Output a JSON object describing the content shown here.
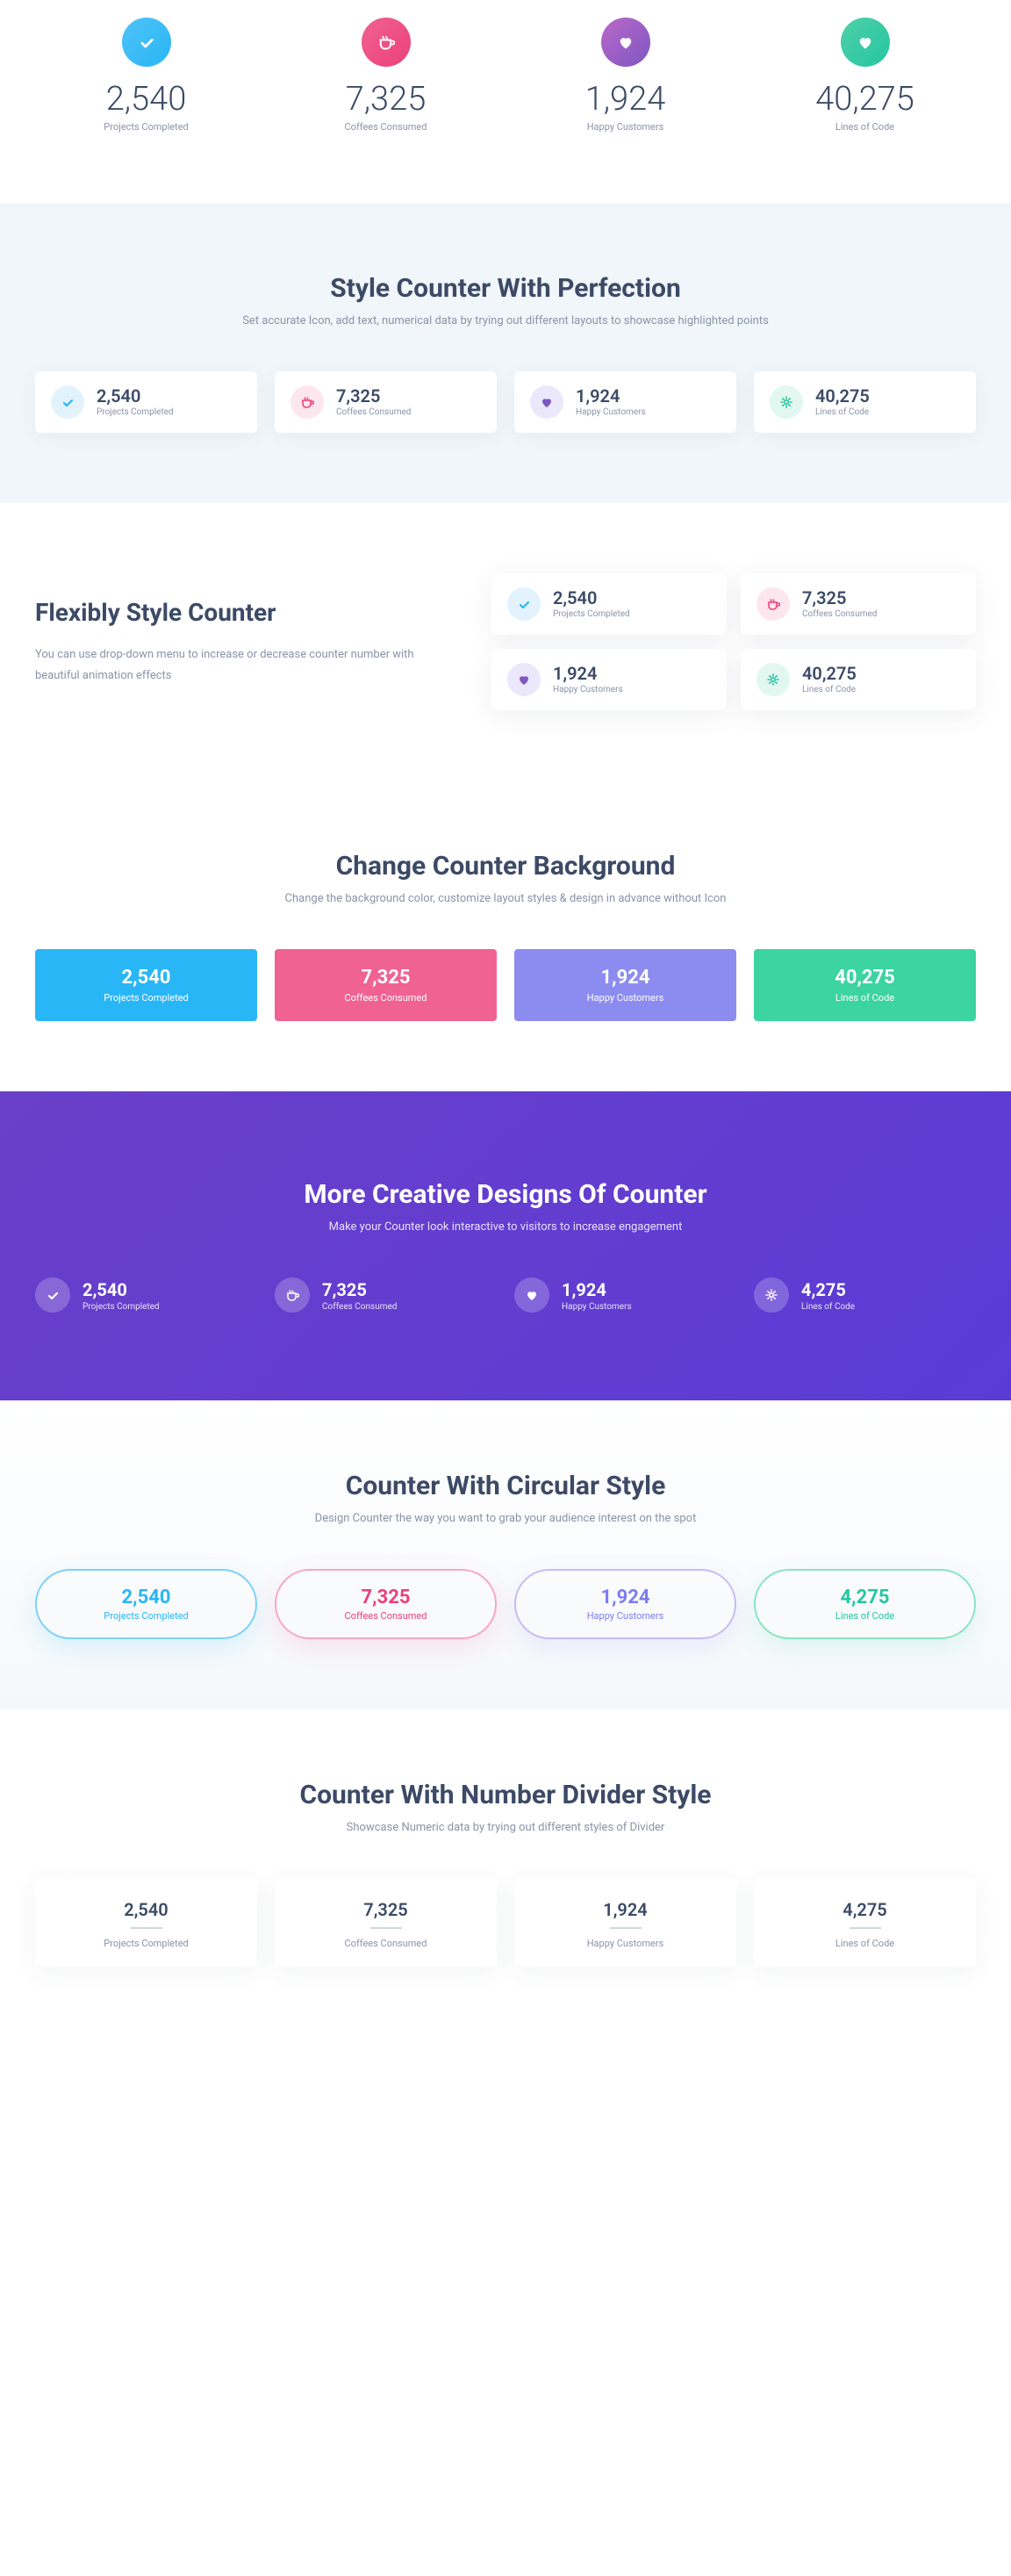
{
  "hero": {
    "items": [
      {
        "value": "2,540",
        "label": "Projects Completed",
        "icon": "check"
      },
      {
        "value": "7,325",
        "label": "Coffees Consumed",
        "icon": "coffee"
      },
      {
        "value": "1,924",
        "label": "Happy Customers",
        "icon": "heart"
      },
      {
        "value": "40,275",
        "label": "Lines of Code",
        "icon": "heart"
      }
    ]
  },
  "s2": {
    "title": "Style Counter With Perfection",
    "sub": "Set accurate Icon, add text, numerical data by trying out different layouts to showcase highlighted points",
    "items": [
      {
        "value": "2,540",
        "label": "Projects Completed",
        "icon": "check"
      },
      {
        "value": "7,325",
        "label": "Coffees Consumed",
        "icon": "coffee"
      },
      {
        "value": "1,924",
        "label": "Happy Customers",
        "icon": "heart"
      },
      {
        "value": "40,275",
        "label": "Lines of Code",
        "icon": "gear"
      }
    ]
  },
  "s3": {
    "title": "Flexibly Style Counter",
    "desc": "You can use drop-down menu to increase or decrease counter number with beautiful animation effects",
    "items": [
      {
        "value": "2,540",
        "label": "Projects Completed",
        "icon": "check"
      },
      {
        "value": "7,325",
        "label": "Coffees Consumed",
        "icon": "coffee"
      },
      {
        "value": "1,924",
        "label": "Happy Customers",
        "icon": "heart"
      },
      {
        "value": "40,275",
        "label": "Lines of Code",
        "icon": "gear"
      }
    ]
  },
  "s4": {
    "title": "Change Counter Background",
    "sub": "Change the background color, customize layout styles & design in advance without Icon",
    "items": [
      {
        "value": "2,540",
        "label": "Projects Completed"
      },
      {
        "value": "7,325",
        "label": "Coffees Consumed"
      },
      {
        "value": "1,924",
        "label": "Happy Customers"
      },
      {
        "value": "40,275",
        "label": "Lines of Code"
      }
    ]
  },
  "s5": {
    "title": "More Creative Designs Of Counter",
    "sub": "Make your Counter look interactive to visitors to increase engagement",
    "items": [
      {
        "value": "2,540",
        "label": "Projects Completed",
        "icon": "check"
      },
      {
        "value": "7,325",
        "label": "Coffees Consumed",
        "icon": "coffee"
      },
      {
        "value": "1,924",
        "label": "Happy Customers",
        "icon": "heart"
      },
      {
        "value": "4,275",
        "label": "Lines of Code",
        "icon": "gear"
      }
    ]
  },
  "s6": {
    "title": "Counter With Circular Style",
    "sub": "Design Counter the way you want to grab your audience interest on the spot",
    "items": [
      {
        "value": "2,540",
        "label": "Projects Completed"
      },
      {
        "value": "7,325",
        "label": "Coffees Consumed"
      },
      {
        "value": "1,924",
        "label": "Happy Customers"
      },
      {
        "value": "4,275",
        "label": "Lines of Code"
      }
    ]
  },
  "s7": {
    "title": "Counter With Number Divider Style",
    "sub": "Showcase Numeric data by trying out different styles of Divider",
    "items": [
      {
        "value": "2,540",
        "label": "Projects Completed"
      },
      {
        "value": "7,325",
        "label": "Coffees Consumed"
      },
      {
        "value": "1,924",
        "label": "Happy Customers"
      },
      {
        "value": "4,275",
        "label": "Lines of Code"
      }
    ]
  }
}
